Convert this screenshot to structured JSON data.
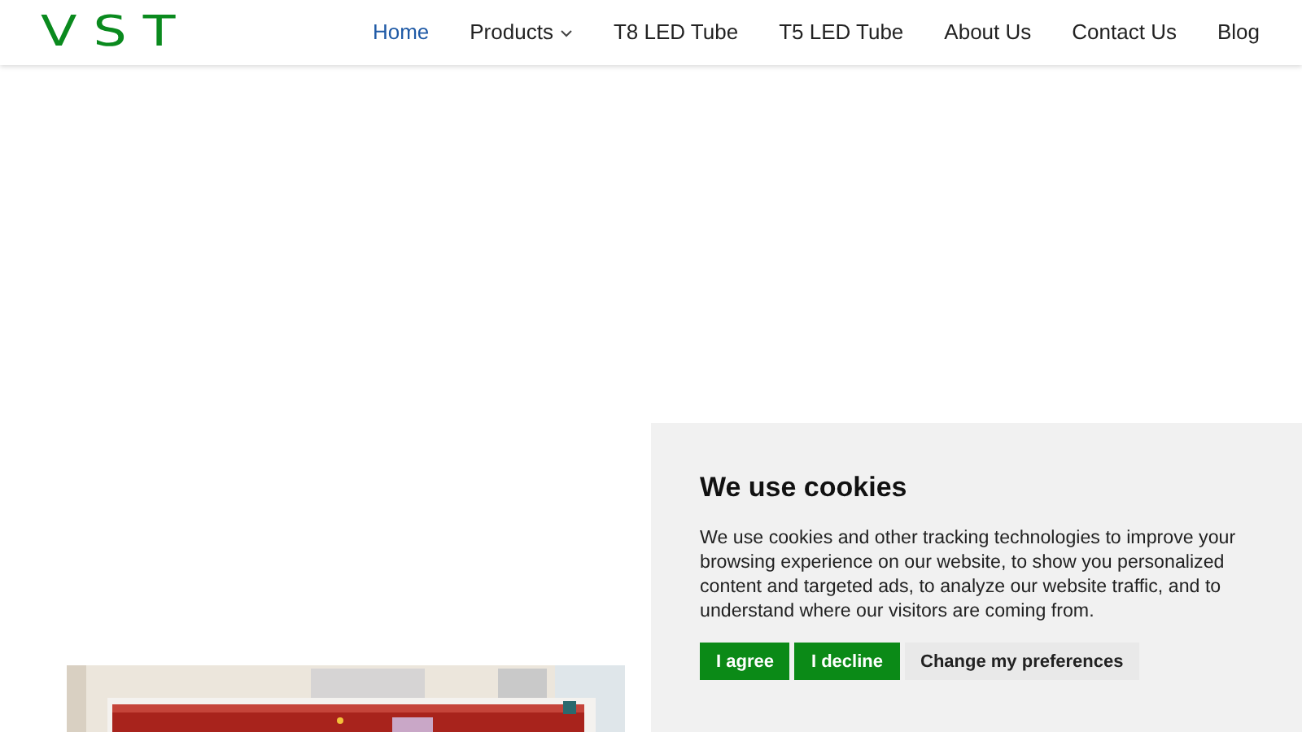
{
  "logo": "VST",
  "nav": [
    {
      "label": "Home",
      "selected": true,
      "dropdown": false
    },
    {
      "label": "Products",
      "selected": false,
      "dropdown": true
    },
    {
      "label": "T8 LED Tube",
      "selected": false,
      "dropdown": false
    },
    {
      "label": "T5 LED Tube",
      "selected": false,
      "dropdown": false
    },
    {
      "label": "About Us",
      "selected": false,
      "dropdown": false
    },
    {
      "label": "Contact Us",
      "selected": false,
      "dropdown": false
    },
    {
      "label": "Blog",
      "selected": false,
      "dropdown": false
    }
  ],
  "cookie_banner": {
    "title": "We use cookies",
    "text": "We use cookies and other tracking technologies to improve your browsing experience on our website, to show you personalized content and targeted ads, to analyze our website traffic, and to understand where our visitors are coming from.",
    "buttons": [
      {
        "label": "I agree",
        "kind": "primary"
      },
      {
        "label": "I decline",
        "kind": "primary"
      },
      {
        "label": "Change my preferences",
        "kind": "secondary"
      }
    ]
  }
}
